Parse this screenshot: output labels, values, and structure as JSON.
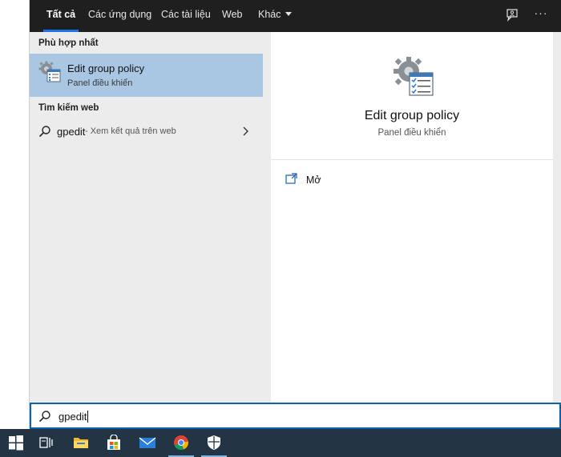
{
  "tabs": [
    {
      "label": "Tất cả",
      "active": true
    },
    {
      "label": "Các ứng dụng"
    },
    {
      "label": "Các tài liệu"
    },
    {
      "label": "Web"
    },
    {
      "label": "Khác"
    }
  ],
  "toolbar_icons": {
    "feedback": "feedback-icon",
    "more": "more-options-icon"
  },
  "sections": {
    "best_match": "Phù hợp nhất",
    "web_search": "Tìm kiếm web"
  },
  "best_match": {
    "title": "Edit group policy",
    "subtitle": "Panel điều khiển",
    "icon": "control-panel-gear-icon"
  },
  "web_result": {
    "query": "gpedit",
    "hint": " - Xem kết quả trên web",
    "icon": "search-icon"
  },
  "preview": {
    "title": "Edit group policy",
    "subtitle": "Panel điều khiển",
    "actions": [
      {
        "label": "Mở",
        "icon": "open-icon"
      }
    ]
  },
  "search": {
    "value": "gpedit",
    "icon": "search-icon"
  },
  "taskbar": {
    "items": [
      "start-icon",
      "task-view-icon",
      "file-explorer-icon",
      "store-icon",
      "mail-icon",
      "chrome-icon",
      "windows-security-icon"
    ]
  },
  "colors": {
    "accent": "#1a73e8",
    "selected_row": "#a9c7e2",
    "taskbar": "#233444",
    "tabbar": "#1f1f1f"
  }
}
